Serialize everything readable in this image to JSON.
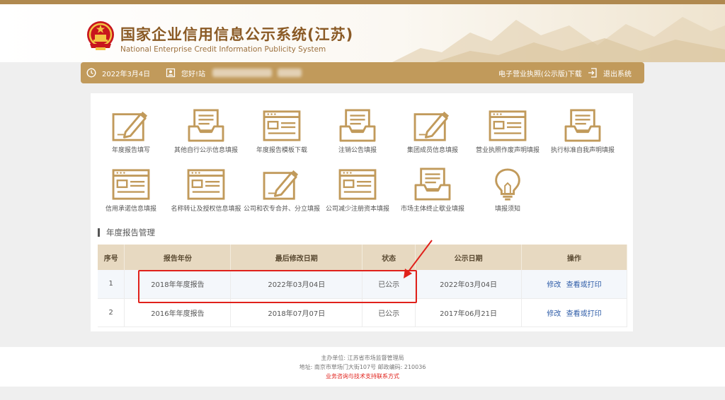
{
  "header": {
    "title_cn": "国家企业信用信息公示系统(江苏)",
    "title_en": "National Enterprise Credit Information Publicity System"
  },
  "bar": {
    "date": "2022年3月4日",
    "greeting": "您好!站",
    "license_download": "电子营业执照(公示版)下载",
    "logout": "退出系统"
  },
  "menu": [
    {
      "label": "年度报告填写",
      "icon": "form-pen-icon"
    },
    {
      "label": "其他自行公示信息填报",
      "icon": "tray-doc-icon"
    },
    {
      "label": "年度报告模板下载",
      "icon": "card-list-icon"
    },
    {
      "label": "注销公告填报",
      "icon": "tray-doc-icon"
    },
    {
      "label": "集团成员信息填报",
      "icon": "form-pen-icon"
    },
    {
      "label": "营业执照作废声明填报",
      "icon": "card-list-icon"
    },
    {
      "label": "执行标准自我声明填报",
      "icon": "tray-doc-icon"
    },
    {
      "label": "信用承诺信息填报",
      "icon": "card-list-icon"
    },
    {
      "label": "名称转让及授权信息填报",
      "icon": "card-list-icon"
    },
    {
      "label": "公司和农专合并、分立填报",
      "icon": "form-pen-icon"
    },
    {
      "label": "公司减少注册资本填报",
      "icon": "card-list-icon"
    },
    {
      "label": "市场主体终止歇业填报",
      "icon": "tray-doc-icon"
    },
    {
      "label": "填报须知",
      "icon": "lightbulb-icon"
    }
  ],
  "section_title": "年度报告管理",
  "table": {
    "headers": [
      "序号",
      "报告年份",
      "最后修改日期",
      "状态",
      "公示日期",
      "操作"
    ],
    "rows": [
      {
        "no": "1",
        "year": "2018年年度报告",
        "modified": "2022年03月04日",
        "status": "已公示",
        "published": "2022年03月04日",
        "edit": "修改",
        "view": "查看或打印"
      },
      {
        "no": "2",
        "year": "2016年年度报告",
        "modified": "2018年07月07日",
        "status": "已公示",
        "published": "2017年06月21日",
        "edit": "修改",
        "view": "查看或打印"
      }
    ]
  },
  "footer": {
    "sponsor": "主办单位:  江苏省市场监督管理局",
    "address": "地址:  南京市草场门大街107号      邮政编码:  210036",
    "support": "业务咨询与技术支持联系方式"
  },
  "colors": {
    "brand": "#c19a5b",
    "highlight": "#e0211b",
    "link": "#2f5da8"
  }
}
